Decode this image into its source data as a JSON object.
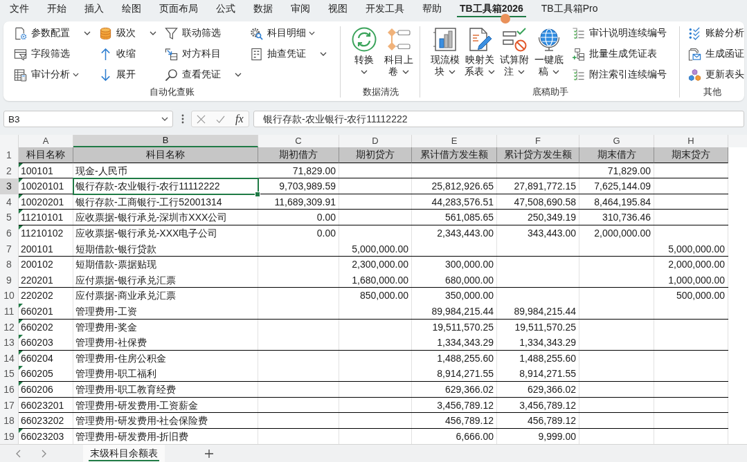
{
  "menu_tabs": [
    {
      "label": "文件",
      "selected": false
    },
    {
      "label": "开始",
      "selected": false
    },
    {
      "label": "插入",
      "selected": false
    },
    {
      "label": "绘图",
      "selected": false
    },
    {
      "label": "页面布局",
      "selected": false
    },
    {
      "label": "公式",
      "selected": false
    },
    {
      "label": "数据",
      "selected": false
    },
    {
      "label": "审阅",
      "selected": false
    },
    {
      "label": "视图",
      "selected": false
    },
    {
      "label": "开发工具",
      "selected": false
    },
    {
      "label": "帮助",
      "selected": false
    },
    {
      "label": "TB工具箱2026",
      "selected": true
    },
    {
      "label": "TB工具箱Pro",
      "selected": false
    }
  ],
  "ribbon": {
    "groups": [
      {
        "label": "自动化查账",
        "items": [
          {
            "label": "参数配置",
            "kind": "small-split"
          },
          {
            "label": "字段筛选",
            "kind": "small"
          },
          {
            "label": "审计分析",
            "kind": "small-menu"
          },
          {
            "label": "级次",
            "kind": "small-split"
          },
          {
            "label": "收缩",
            "kind": "small"
          },
          {
            "label": "展开",
            "kind": "small"
          },
          {
            "label": "联动筛选",
            "kind": "small"
          },
          {
            "label": "对方科目",
            "kind": "small"
          },
          {
            "label": "查看凭证",
            "kind": "small-split"
          },
          {
            "label": "科目明细",
            "kind": "small-menu"
          },
          {
            "label": "抽查凭证",
            "kind": "small-split"
          }
        ]
      },
      {
        "label": "数据清洗",
        "items": [
          {
            "label": "转换",
            "kind": "large-menu"
          },
          {
            "label": "科目上卷",
            "kind": "large-menu"
          }
        ]
      },
      {
        "label": "底稿助手",
        "items": [
          {
            "label": "现流模块",
            "kind": "large-menu"
          },
          {
            "label": "映射关系表",
            "kind": "large-menu"
          },
          {
            "label": "试算附注",
            "kind": "large-menu"
          },
          {
            "label": "一键底稿",
            "kind": "large-menu"
          },
          {
            "label": "审计说明连续编号",
            "kind": "small"
          },
          {
            "label": "批量生成凭证表",
            "kind": "small"
          },
          {
            "label": "附注索引连续编号",
            "kind": "small"
          }
        ]
      },
      {
        "label": "其他",
        "items": [
          {
            "label": "账龄分析",
            "kind": "small"
          },
          {
            "label": "生成函证",
            "kind": "small"
          },
          {
            "label": "更新表头",
            "kind": "small"
          }
        ]
      }
    ]
  },
  "formula_bar": {
    "name_box": "B3",
    "function_label": "fx",
    "formula": "银行存款-农业银行-农行11112222"
  },
  "sheet": {
    "columns": [
      {
        "letter": "A",
        "selected": false
      },
      {
        "letter": "B",
        "selected": true
      },
      {
        "letter": "C",
        "selected": false
      },
      {
        "letter": "D",
        "selected": false
      },
      {
        "letter": "E",
        "selected": false
      },
      {
        "letter": "F",
        "selected": false
      },
      {
        "letter": "G",
        "selected": false
      },
      {
        "letter": "H",
        "selected": false
      }
    ],
    "header_row": {
      "row_number": "1",
      "cells": [
        "科目名称",
        "科目名称",
        "期初借方",
        "期初贷方",
        "累计借方发生额",
        "累计贷方发生额",
        "期末借方",
        "期末贷方"
      ]
    },
    "rows": [
      {
        "row_number": "2",
        "selected": false,
        "flag": true,
        "border_below": true,
        "code": "100101",
        "name": "现金-人民币",
        "open_dr": "71,829.00",
        "close_dr": "71,829.00"
      },
      {
        "row_number": "3",
        "selected": true,
        "flag": true,
        "border_below": true,
        "code": "10020101",
        "name": "银行存款-农业银行-农行11112222",
        "open_dr": "9,703,989.59",
        "period_dr": "25,812,926.65",
        "period_cr": "27,891,772.15",
        "close_dr": "7,625,144.09"
      },
      {
        "row_number": "4",
        "selected": false,
        "flag": true,
        "border_below": true,
        "code": "10020201",
        "name": "银行存款-工商银行-工行52001314",
        "open_dr": "11,689,309.91",
        "period_dr": "44,283,576.51",
        "period_cr": "47,508,690.58",
        "close_dr": "8,464,195.84"
      },
      {
        "row_number": "5",
        "selected": false,
        "flag": true,
        "border_below": true,
        "code": "11210101",
        "name": "应收票据-银行承兑-深圳市XXX公司",
        "open_dr": "0.00",
        "period_dr": "561,085.65",
        "period_cr": "250,349.19",
        "close_dr": "310,736.46"
      },
      {
        "row_number": "6",
        "selected": false,
        "flag": true,
        "border_below": false,
        "code": "11210102",
        "name": "应收票据-银行承兑-XXX电子公司",
        "open_dr": "0.00",
        "period_dr": "2,343,443.00",
        "period_cr": "343,443.00",
        "close_dr": "2,000,000.00"
      },
      {
        "row_number": "7",
        "selected": false,
        "flag": false,
        "border_below": true,
        "code": "200101",
        "name": "短期借款-银行贷款",
        "open_cr": "5,000,000.00",
        "close_cr": "5,000,000.00"
      },
      {
        "row_number": "8",
        "selected": false,
        "flag": false,
        "border_below": false,
        "code": "200102",
        "name": "短期借款-票据贴现",
        "open_cr": "2,300,000.00",
        "period_dr": "300,000.00",
        "close_cr": "2,000,000.00"
      },
      {
        "row_number": "9",
        "selected": false,
        "flag": false,
        "border_below": true,
        "code": "220201",
        "name": "应付票据-银行承兑汇票",
        "open_cr": "1,680,000.00",
        "period_dr": "680,000.00",
        "close_cr": "1,000,000.00"
      },
      {
        "row_number": "10",
        "selected": false,
        "flag": false,
        "border_below": false,
        "code": "220202",
        "name": "应付票据-商业承兑汇票",
        "open_cr": "850,000.00",
        "period_dr": "350,000.00",
        "close_cr": "500,000.00"
      },
      {
        "row_number": "11",
        "selected": false,
        "flag": true,
        "border_below": true,
        "code": "660201",
        "name": "管理费用-工资",
        "period_dr": "89,984,215.44",
        "period_cr": "89,984,215.44"
      },
      {
        "row_number": "12",
        "selected": false,
        "flag": true,
        "border_below": false,
        "code": "660202",
        "name": "管理费用-奖金",
        "period_dr": "19,511,570.25",
        "period_cr": "19,511,570.25"
      },
      {
        "row_number": "13",
        "selected": false,
        "flag": true,
        "border_below": true,
        "code": "660203",
        "name": "管理费用-社保费",
        "period_dr": "1,334,343.29",
        "period_cr": "1,334,343.29"
      },
      {
        "row_number": "14",
        "selected": false,
        "flag": true,
        "border_below": false,
        "code": "660204",
        "name": "管理费用-住房公积金",
        "period_dr": "1,488,255.60",
        "period_cr": "1,488,255.60"
      },
      {
        "row_number": "15",
        "selected": false,
        "flag": true,
        "border_below": true,
        "code": "660205",
        "name": "管理费用-职工福利",
        "period_dr": "8,914,271.55",
        "period_cr": "8,914,271.55"
      },
      {
        "row_number": "16",
        "selected": false,
        "flag": true,
        "border_below": true,
        "code": "660206",
        "name": "管理费用-职工教育经费",
        "period_dr": "629,366.02",
        "period_cr": "629,366.02"
      },
      {
        "row_number": "17",
        "selected": false,
        "flag": false,
        "border_below": true,
        "code": "66023201",
        "name": "管理费用-研发费用-工资薪金",
        "period_dr": "3,456,789.12",
        "period_cr": "3,456,789.12"
      },
      {
        "row_number": "18",
        "selected": false,
        "flag": false,
        "border_below": true,
        "code": "66023202",
        "name": "管理费用-研发费用-社会保险费",
        "period_dr": "456,789.12",
        "period_cr": "456,789.12"
      },
      {
        "row_number": "19",
        "selected": false,
        "flag": true,
        "border_below": false,
        "code": "66023203",
        "name": "管理费用-研发费用-折旧费",
        "period_dr": "6,666.00",
        "period_cr": "9,999.00"
      }
    ]
  },
  "sheet_tabs": [
    {
      "label": "末级科目余额表",
      "selected": true
    }
  ]
}
